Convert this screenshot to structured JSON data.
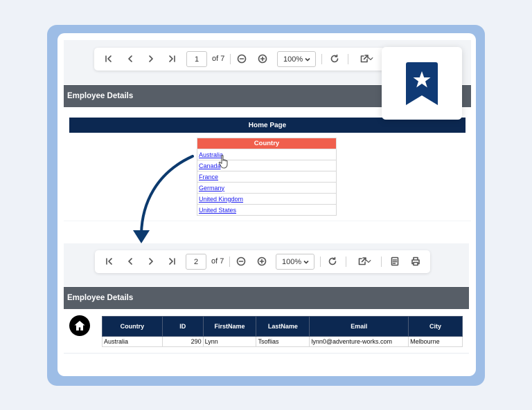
{
  "toolbar_top": {
    "page_value": "1",
    "of_pages": "of 7",
    "zoom": "100%"
  },
  "toolbar_bottom": {
    "page_value": "2",
    "of_pages": "of 7",
    "zoom": "100%"
  },
  "report_top": {
    "section_title": "Employee Details",
    "home_title": "Home Page",
    "country_header": "Country",
    "countries": [
      "Australia",
      "Canada",
      "France",
      "Germany",
      "United Kingdom",
      "United States"
    ]
  },
  "report_bottom": {
    "section_title": "Employee Details",
    "columns": [
      "Country",
      "ID",
      "FirstName",
      "LastName",
      "Email",
      "City"
    ],
    "row": [
      "Australia",
      "290",
      "Lynn",
      "Tsoflias",
      "lynn0@adventure-works.com",
      "Melbourne"
    ]
  },
  "colors": {
    "frame": "#9dbde6",
    "navy": "#0c2851",
    "header_gray": "#575e67",
    "country_header": "#f05f4d",
    "link": "#1a1aee"
  },
  "icons": [
    "first-page-icon",
    "prev-page-icon",
    "next-page-icon",
    "last-page-icon",
    "zoom-out-icon",
    "zoom-in-icon",
    "refresh-icon",
    "export-icon",
    "print-layout-icon",
    "print-icon",
    "bookmark-star-icon",
    "home-icon",
    "hand-cursor-icon"
  ]
}
